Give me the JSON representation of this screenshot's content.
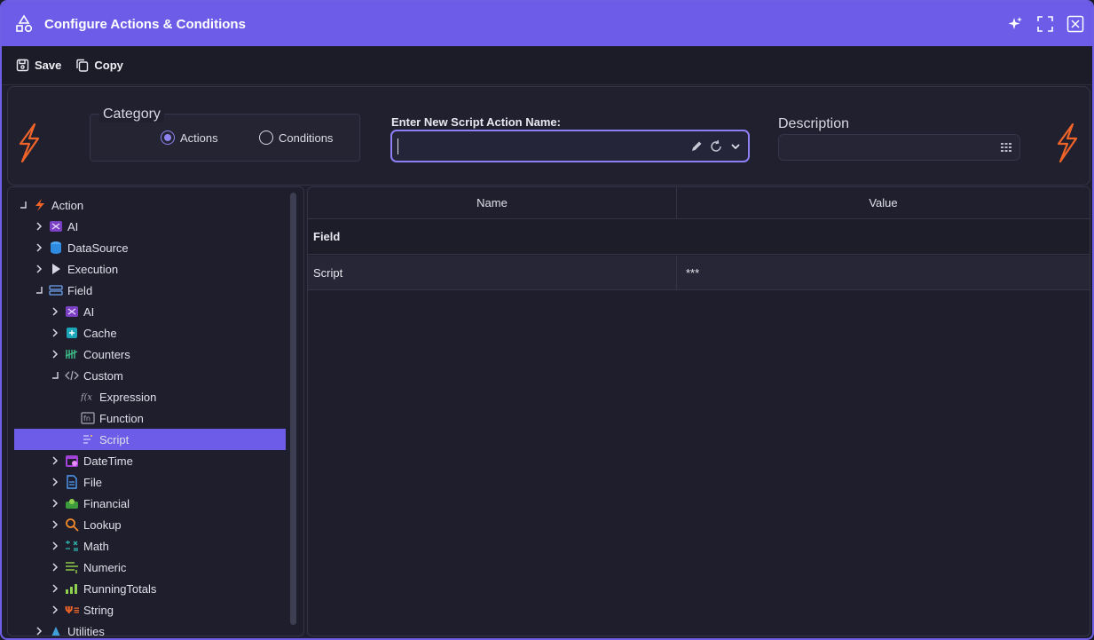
{
  "window": {
    "title": "Configure Actions & Conditions"
  },
  "toolbar": {
    "save_label": "Save",
    "copy_label": "Copy"
  },
  "filter": {
    "category_label": "Category",
    "options": [
      {
        "label": "Actions",
        "selected": true
      },
      {
        "label": "Conditions",
        "selected": false
      }
    ],
    "name_label": "Enter New Script Action Name:",
    "name_value": "",
    "description_label": "Description",
    "description_value": ""
  },
  "tree": {
    "items": [
      {
        "label": "Action",
        "icon": "lightning-icon",
        "level": 0,
        "state": "expanded"
      },
      {
        "label": "AI",
        "icon": "ai-icon",
        "level": 1,
        "state": "collapsed"
      },
      {
        "label": "DataSource",
        "icon": "database-icon",
        "level": 1,
        "state": "collapsed"
      },
      {
        "label": "Execution",
        "icon": "play-icon",
        "level": 1,
        "state": "collapsed"
      },
      {
        "label": "Field",
        "icon": "field-icon",
        "level": 1,
        "state": "expanded"
      },
      {
        "label": "AI",
        "icon": "ai-icon",
        "level": 2,
        "state": "collapsed"
      },
      {
        "label": "Cache",
        "icon": "cache-icon",
        "level": 2,
        "state": "collapsed"
      },
      {
        "label": "Counters",
        "icon": "counters-icon",
        "level": 2,
        "state": "collapsed"
      },
      {
        "label": "Custom",
        "icon": "code-icon",
        "level": 2,
        "state": "expanded"
      },
      {
        "label": "Expression",
        "icon": "expression-icon",
        "level": 3,
        "state": "leaf"
      },
      {
        "label": "Function",
        "icon": "function-icon",
        "level": 3,
        "state": "leaf"
      },
      {
        "label": "Script",
        "icon": "script-icon",
        "level": 3,
        "state": "leaf",
        "selected": true
      },
      {
        "label": "DateTime",
        "icon": "calendar-icon",
        "level": 2,
        "state": "collapsed"
      },
      {
        "label": "File",
        "icon": "file-icon",
        "level": 2,
        "state": "collapsed"
      },
      {
        "label": "Financial",
        "icon": "financial-icon",
        "level": 2,
        "state": "collapsed"
      },
      {
        "label": "Lookup",
        "icon": "search-icon",
        "level": 2,
        "state": "collapsed"
      },
      {
        "label": "Math",
        "icon": "math-icon",
        "level": 2,
        "state": "collapsed"
      },
      {
        "label": "Numeric",
        "icon": "numeric-icon",
        "level": 2,
        "state": "collapsed"
      },
      {
        "label": "RunningTotals",
        "icon": "chart-icon",
        "level": 2,
        "state": "collapsed"
      },
      {
        "label": "String",
        "icon": "string-icon",
        "level": 2,
        "state": "collapsed"
      },
      {
        "label": "Utilities",
        "icon": "utilities-icon",
        "level": 1,
        "state": "collapsed"
      }
    ]
  },
  "grid": {
    "headers": {
      "name": "Name",
      "value": "Value"
    },
    "group": "Field",
    "rows": [
      {
        "name": "Script",
        "value": "***"
      }
    ]
  },
  "colors": {
    "accent": "#6c5ce7",
    "bolt": "#f0642a"
  }
}
